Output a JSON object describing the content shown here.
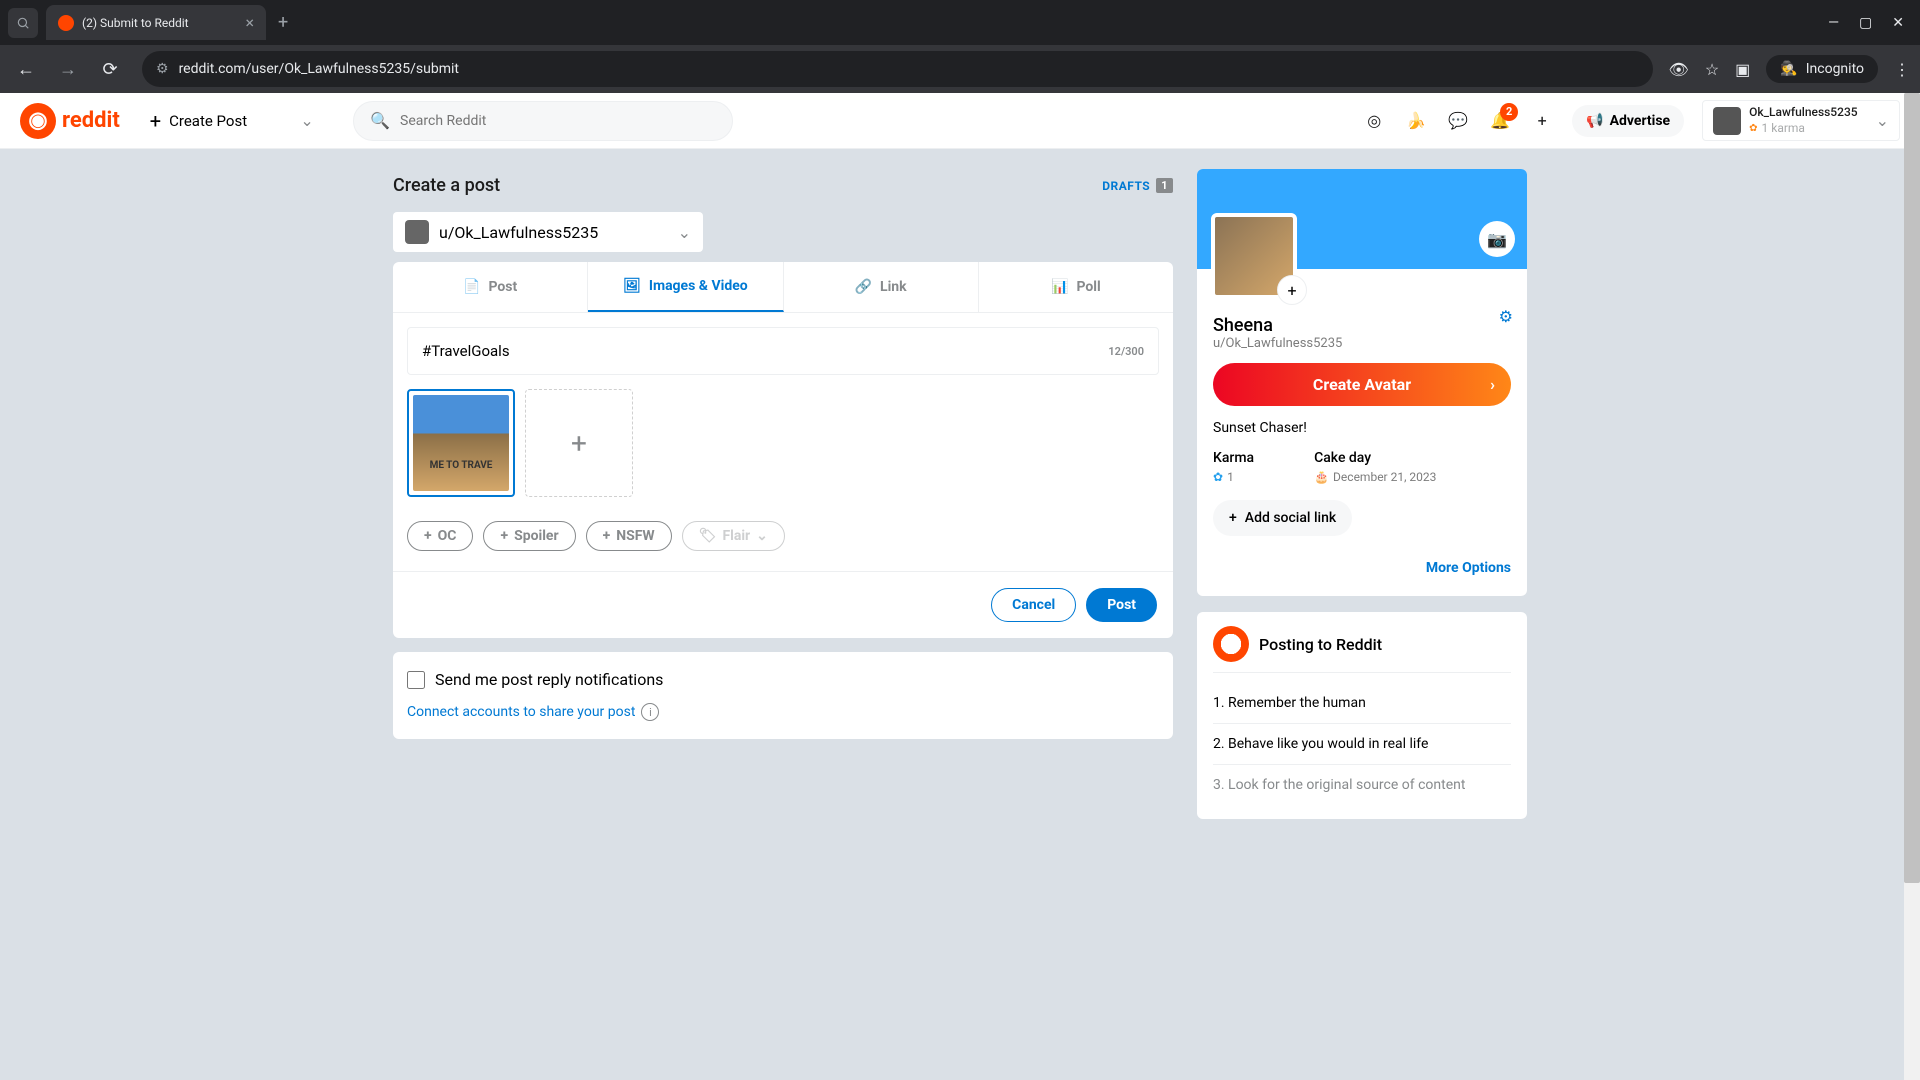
{
  "browser": {
    "tab_title": "(2) Submit to Reddit",
    "url": "reddit.com/user/Ok_Lawfulness5235/submit",
    "incognito_label": "Incognito"
  },
  "header": {
    "brand": "reddit",
    "create_post": "Create Post",
    "search_placeholder": "Search Reddit",
    "advertise": "Advertise",
    "notif_count": "2",
    "user": {
      "name": "Ok_Lawfulness5235",
      "karma_line": "1 karma"
    }
  },
  "page": {
    "title": "Create a post",
    "drafts_label": "DRAFTS",
    "drafts_count": "1",
    "community": "u/Ok_Lawfulness5235",
    "tabs": {
      "post": "Post",
      "images": "Images & Video",
      "link": "Link",
      "poll": "Poll"
    },
    "post_title": "#TravelGoals",
    "char_count": "12/300",
    "thumb_text": "ME TO TRAVE",
    "tags": {
      "oc": "OC",
      "spoiler": "Spoiler",
      "nsfw": "NSFW",
      "flair": "Flair"
    },
    "cancel": "Cancel",
    "post_btn": "Post",
    "notify_label": "Send me post reply notifications",
    "connect_label": "Connect accounts to share your post"
  },
  "sidebar": {
    "display_name": "Sheena",
    "handle": "u/Ok_Lawfulness5235",
    "create_avatar": "Create Avatar",
    "bio": "Sunset Chaser!",
    "karma_label": "Karma",
    "karma_value": "1",
    "cake_label": "Cake day",
    "cake_value": "December 21, 2023",
    "add_social": "Add social link",
    "more_options": "More Options",
    "rules_title": "Posting to Reddit",
    "rules": {
      "r1": "1. Remember the human",
      "r2": "2. Behave like you would in real life",
      "r3": "3. Look for the original source of content"
    }
  }
}
